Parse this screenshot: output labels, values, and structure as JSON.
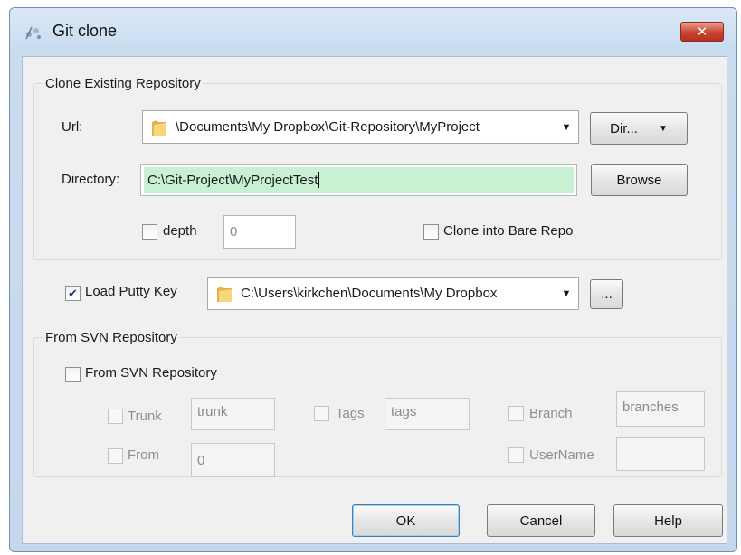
{
  "window": {
    "title": "Git clone",
    "close_label": "✕"
  },
  "clone_group": {
    "title": "Clone Existing Repository",
    "url_label": "Url:",
    "url_value": "\\Documents\\My Dropbox\\Git-Repository\\MyProject",
    "dir_button": "Dir...",
    "directory_label": "Directory:",
    "directory_value": "C:\\Git-Project\\MyProjectTest",
    "browse_button": "Browse",
    "depth_label": "depth",
    "depth_checked": false,
    "depth_value": "0",
    "bare_label": "Clone into Bare Repo",
    "bare_checked": false
  },
  "putty": {
    "label": "Load Putty Key",
    "checked": true,
    "value": "C:\\Users\\kirkchen\\Documents\\My Dropbox",
    "browse_button": "..."
  },
  "svn_group": {
    "title": "From SVN Repository",
    "enable_label": "From SVN Repository",
    "trunk_label": "Trunk",
    "trunk_value": "trunk",
    "tags_label": "Tags",
    "tags_value": "tags",
    "branch_label": "Branch",
    "branch_value": "branches",
    "from_label": "From",
    "from_value": "0",
    "username_label": "UserName",
    "username_value": ""
  },
  "buttons": {
    "ok": "OK",
    "cancel": "Cancel",
    "help": "Help"
  },
  "colors": {
    "titlebar": "#c9dcf0",
    "close": "#c8442f",
    "highlight": "#c8f0d2",
    "client": "#f0f0f0"
  }
}
